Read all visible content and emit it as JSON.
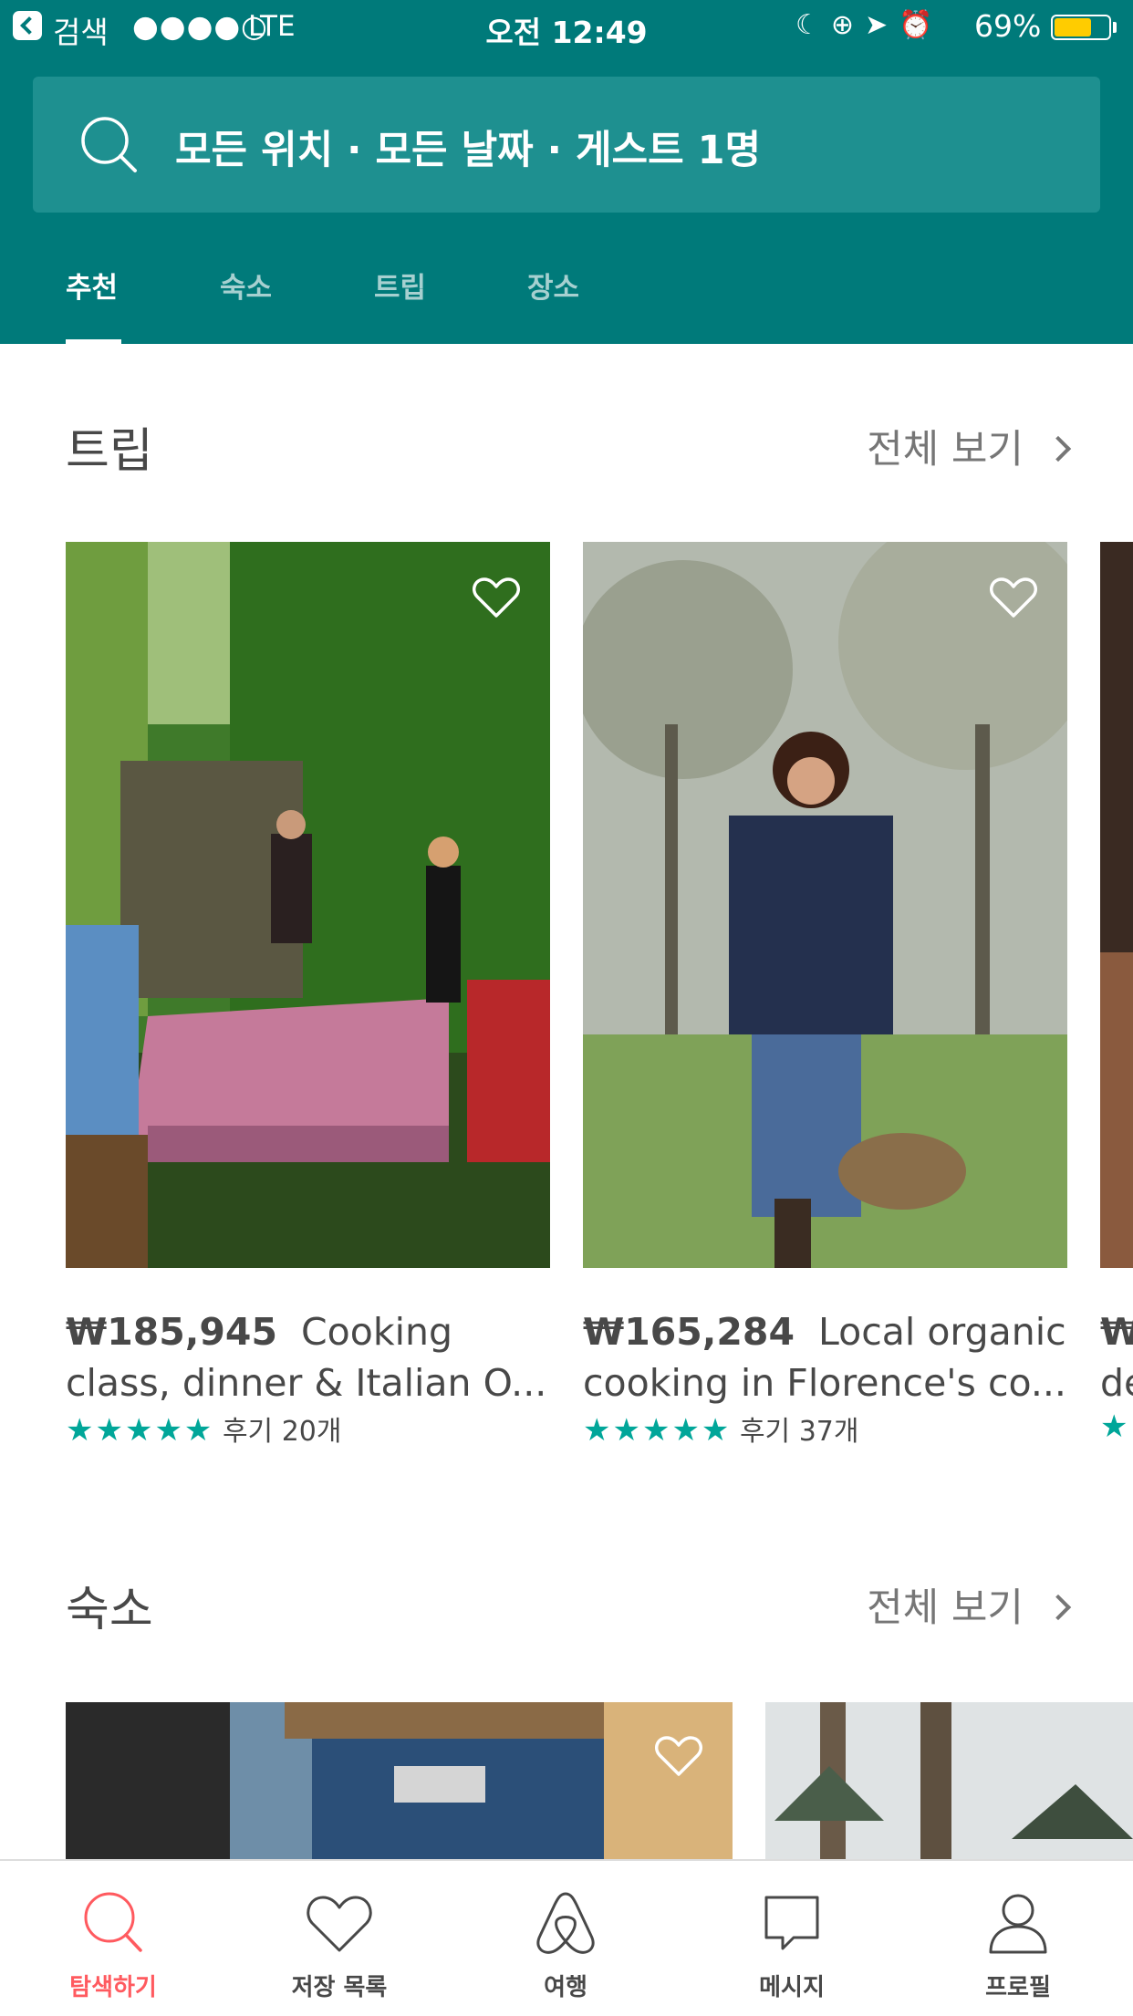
{
  "status_bar": {
    "carrier": "검색",
    "signal": "●●●●○",
    "network": "LTE",
    "time": "오전 12:49",
    "battery": "69%",
    "battery_level": 0.69,
    "icons": [
      "moon-icon",
      "rotation-lock-icon",
      "location-icon",
      "alarm-icon"
    ]
  },
  "search": {
    "text": "모든 위치 · 모든 날짜 · 게스트 1명"
  },
  "tabs": [
    {
      "label": "추천",
      "active": true
    },
    {
      "label": "숙소",
      "active": false
    },
    {
      "label": "트립",
      "active": false
    },
    {
      "label": "장소",
      "active": false
    }
  ],
  "sections": {
    "trips": {
      "title": "트립",
      "see_all": "전체 보기",
      "cards": [
        {
          "price": "₩185,945",
          "title_line1": "Cooking",
          "title_line2": "class, dinner & Italian O...",
          "stars": "★★★★★",
          "reviews": "후기 20개"
        },
        {
          "price": "₩165,284",
          "title_line1": "Local organic",
          "title_line2": "cooking in Florence's co...",
          "stars": "★★★★★",
          "reviews": "후기 37개"
        },
        {
          "price": "₩",
          "title_line1": "",
          "title_line2": "de",
          "stars": "★",
          "reviews": ""
        }
      ]
    },
    "homes": {
      "title": "숙소",
      "see_all": "전체 보기"
    }
  },
  "bottom_nav": [
    {
      "label": "탐색하기",
      "icon": "search-icon",
      "active": true
    },
    {
      "label": "저장 목록",
      "icon": "heart-icon",
      "active": false
    },
    {
      "label": "여행",
      "icon": "airbnb-logo-icon",
      "active": false
    },
    {
      "label": "메시지",
      "icon": "message-icon",
      "active": false
    },
    {
      "label": "프로필",
      "icon": "profile-icon",
      "active": false
    }
  ],
  "colors": {
    "header": "#007a7a",
    "search_bg": "#1e9090",
    "accent_active": "#ff5a5f",
    "stars": "#00a699"
  }
}
